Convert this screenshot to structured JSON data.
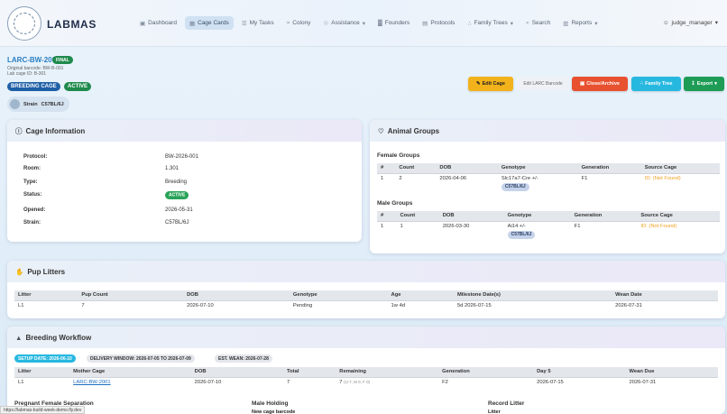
{
  "app": {
    "brand": "LABMAS",
    "logo_icon": "lab-seal-icon"
  },
  "nav": {
    "items": [
      {
        "label": "Dashboard",
        "icon": "dashboard-icon"
      },
      {
        "label": "Cage Cards",
        "icon": "grid-icon",
        "active": true
      },
      {
        "label": "My Tasks",
        "icon": "list-icon"
      },
      {
        "label": "Colony",
        "icon": "chart-line-icon"
      },
      {
        "label": "Assistance",
        "icon": "bulb-icon",
        "dropdown": true
      },
      {
        "label": "Founders",
        "icon": "bar-chart-icon"
      },
      {
        "label": "Protocols",
        "icon": "clipboard-icon"
      },
      {
        "label": "Family Trees",
        "icon": "tree-icon",
        "dropdown": true
      },
      {
        "label": "Search",
        "icon": "search-icon"
      },
      {
        "label": "Reports",
        "icon": "report-icon",
        "dropdown": true
      }
    ],
    "user": "judge_manager"
  },
  "header": {
    "cage_id": "LARC-BW-2001",
    "final_badge": "FINAL",
    "original_barcode": "Original barcode: BW-B-001",
    "lab_cage_id": "Lab cage ID: B-301",
    "type_badge": "BREEDING CAGE",
    "status_badge": "ACTIVE",
    "strain_label": "Strain",
    "strain_value": "C57BL/6J"
  },
  "actions": {
    "edit": "Edit Cage",
    "edit_barcode": "Edit LARC Barcode",
    "close": "Close/Archive",
    "family_tree": "Family Tree",
    "export": "Export"
  },
  "cage_info": {
    "title": "Cage Information",
    "rows": [
      {
        "label": "Protocol:",
        "value": "BW-2026-001"
      },
      {
        "label": "Room:",
        "value": "1.301"
      },
      {
        "label": "Type:",
        "value": "Breeding"
      },
      {
        "label": "Status:",
        "value": "ACTIVE",
        "pill": true
      },
      {
        "label": "Opened:",
        "value": "2026-05-31"
      },
      {
        "label": "Strain:",
        "value": "C57BL/6J"
      }
    ]
  },
  "animal_groups": {
    "title": "Animal Groups",
    "female_title": "Female Groups",
    "male_title": "Male Groups",
    "columns": [
      "#",
      "Count",
      "DOB",
      "Genotype",
      "Generation",
      "Source Cage"
    ],
    "female": [
      {
        "num": "1",
        "count": "2",
        "dob": "2026-04-06",
        "genotype": "Slc17a7-Cre +/-",
        "strain": "C57BL/6J",
        "generation": "F1",
        "source": "ID: (Not Found)"
      }
    ],
    "male": [
      {
        "num": "1",
        "count": "1",
        "dob": "2026-03-30",
        "genotype": "Ai14 +/-",
        "strain": "C57BL/6J",
        "generation": "F1",
        "source": "ID: (Not Found)"
      }
    ]
  },
  "pup_litters": {
    "title": "Pup Litters",
    "columns": [
      "Litter",
      "Pup Count",
      "DOB",
      "Genotype",
      "Age",
      "Milestone Date(s)",
      "Wean Date"
    ],
    "rows": [
      [
        "L1",
        "7",
        "2026-07-10",
        "Pending",
        "1w 4d",
        "5d 2026-07-15",
        "2026-07-31"
      ]
    ]
  },
  "breeding_workflow": {
    "title": "Breeding Workflow",
    "pills": [
      "SETUP DATE: 2026-06-10",
      "DELIVERY WINDOW: 2026-07-05 TO 2026-07-09",
      "EST. WEAN: 2026-07-28"
    ],
    "columns": [
      "Litter",
      "Mother Cage",
      "DOB",
      "Total",
      "Remaining",
      "Generation",
      "Day 5",
      "Wean Due"
    ],
    "rows": [
      {
        "litter": "L1",
        "mother": "LARC-BW-2001",
        "dob": "2026-07-10",
        "total": "7",
        "remaining": "7",
        "remaining_note": "(U 7, M 0, F 0)",
        "generation": "F2",
        "day5": "2026-07-15",
        "wean": "2026-07-31"
      }
    ],
    "sections": [
      "Pregnant Female Separation",
      "Male Holding",
      "Record Litter"
    ],
    "section_sub": [
      "",
      "New cage barcode",
      "Litter"
    ]
  },
  "status_url": "https://labmas-build-week-demo.fly.dev"
}
